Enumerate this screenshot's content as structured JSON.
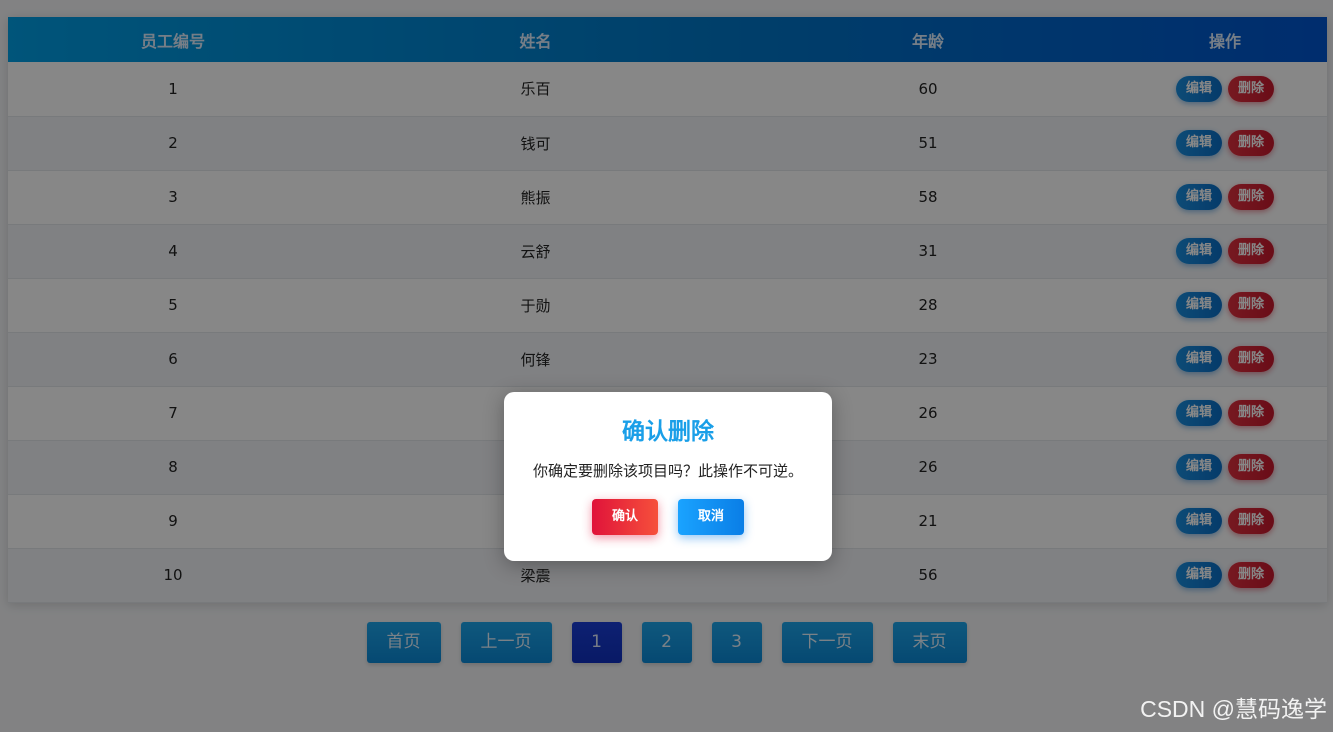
{
  "table": {
    "headers": [
      "员工编号",
      "姓名",
      "年龄",
      "操作"
    ],
    "rows": [
      {
        "id": "1",
        "name": "乐百",
        "age": "60"
      },
      {
        "id": "2",
        "name": "钱可",
        "age": "51"
      },
      {
        "id": "3",
        "name": "熊振",
        "age": "58"
      },
      {
        "id": "4",
        "name": "云舒",
        "age": "31"
      },
      {
        "id": "5",
        "name": "于勋",
        "age": "28"
      },
      {
        "id": "6",
        "name": "何锋",
        "age": "23"
      },
      {
        "id": "7",
        "name": "",
        "age": "26"
      },
      {
        "id": "8",
        "name": "",
        "age": "26"
      },
      {
        "id": "9",
        "name": "",
        "age": "21"
      },
      {
        "id": "10",
        "name": "梁震",
        "age": "56"
      }
    ],
    "edit_label": "编辑",
    "delete_label": "删除"
  },
  "pagination": {
    "first": "首页",
    "prev": "上一页",
    "pages": [
      "1",
      "2",
      "3"
    ],
    "active_page": "1",
    "next": "下一页",
    "last": "末页"
  },
  "modal": {
    "title": "确认删除",
    "message": "你确定要删除该项目吗？此操作不可逆。",
    "confirm_label": "确认",
    "cancel_label": "取消"
  },
  "watermark": "CSDN @慧码逸学",
  "colors": {
    "header_gradient_start": "#00a0e6",
    "header_gradient_end": "#0055d0",
    "edit_button": "#0b6fc8",
    "delete_button": "#c8182d",
    "modal_title": "#1a9fe8"
  }
}
